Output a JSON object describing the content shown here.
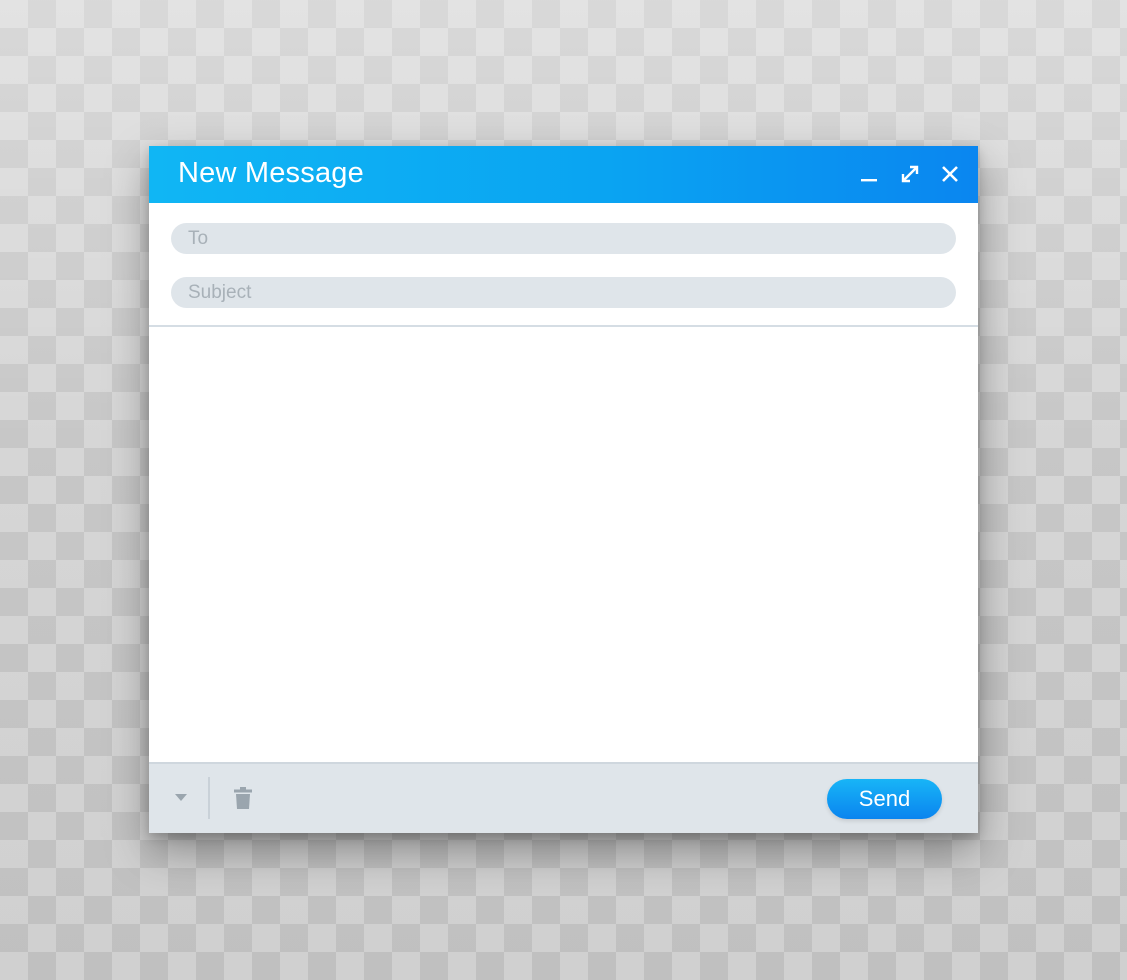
{
  "window": {
    "title": "New Message"
  },
  "fields": {
    "to": {
      "placeholder": "To",
      "value": ""
    },
    "subject": {
      "placeholder": "Subject",
      "value": ""
    },
    "body": {
      "value": ""
    }
  },
  "footer": {
    "send_label": "Send"
  },
  "icons": {
    "minimize": "minimize-icon",
    "maximize": "maximize-icon",
    "close": "close-icon",
    "dropdown": "caret-down-icon",
    "trash": "trash-icon"
  },
  "colors": {
    "accent": "#0aa4f2",
    "accent_dark": "#0a84ef",
    "field_bg": "#dfe5ea",
    "placeholder": "#a8b1b8",
    "footer_bg": "#dfe5ea"
  }
}
